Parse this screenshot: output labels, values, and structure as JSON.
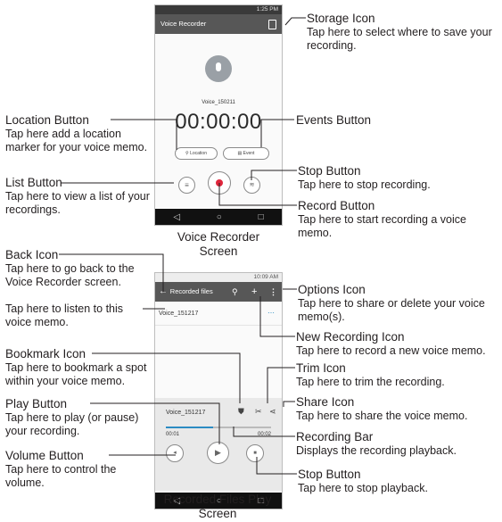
{
  "screen1": {
    "status_time": "1:25 PM",
    "app_title": "Voice Recorder",
    "recording_name": "Voice_150211",
    "timer": "00:00:00",
    "location_label": "Location",
    "event_label": "Event",
    "caption": "Voice Recorder Screen"
  },
  "screen2": {
    "status_time": "10:09 AM",
    "app_title": "Recorded files",
    "list_item": "Voice_151217",
    "player_name": "Voice_151217",
    "time_elapsed": "00:01",
    "time_total": "00:02",
    "playback_fraction": 0.45,
    "caption": "Recorded Files Play Screen"
  },
  "nav_glyphs": {
    "back": "◁",
    "home": "○",
    "recent": "□"
  },
  "callouts": {
    "storage_icon": {
      "title": "Storage Icon",
      "desc": "Tap here to select where to save your recording."
    },
    "location_button": {
      "title": "Location Button",
      "desc": "Tap here add a location marker for your voice memo."
    },
    "events_button": {
      "title": "Events Button",
      "desc": ""
    },
    "list_button": {
      "title": "List Button",
      "desc": "Tap here to view a list of your recordings."
    },
    "stop_button_1": {
      "title": "Stop Button",
      "desc": "Tap here to stop recording."
    },
    "record_button": {
      "title": "Record Button",
      "desc": "Tap here to start recording a voice memo."
    },
    "back_icon": {
      "title": "Back Icon",
      "desc": "Tap here to go back to the Voice Recorder screen."
    },
    "listen": {
      "title": "",
      "desc": "Tap here to listen to this voice memo."
    },
    "options_icon": {
      "title": "Options Icon",
      "desc": "Tap here to share or delete your voice memo(s)."
    },
    "new_recording_icon": {
      "title": "New Recording Icon",
      "desc": "Tap here to record a new voice memo."
    },
    "bookmark_icon": {
      "title": "Bookmark Icon",
      "desc": "Tap here to bookmark a spot within your voice memo."
    },
    "trim_icon": {
      "title": "Trim Icon",
      "desc": "Tap here to trim the recording."
    },
    "play_button": {
      "title": "Play Button",
      "desc": "Tap here to play (or pause) your recording."
    },
    "share_icon": {
      "title": "Share Icon",
      "desc": "Tap here to share the voice memo."
    },
    "recording_bar": {
      "title": "Recording Bar",
      "desc": "Displays the recording playback."
    },
    "volume_button": {
      "title": "Volume Button",
      "desc": "Tap here to control the volume."
    },
    "stop_button_2": {
      "title": "Stop Button",
      "desc": "Tap here to stop playback."
    }
  }
}
